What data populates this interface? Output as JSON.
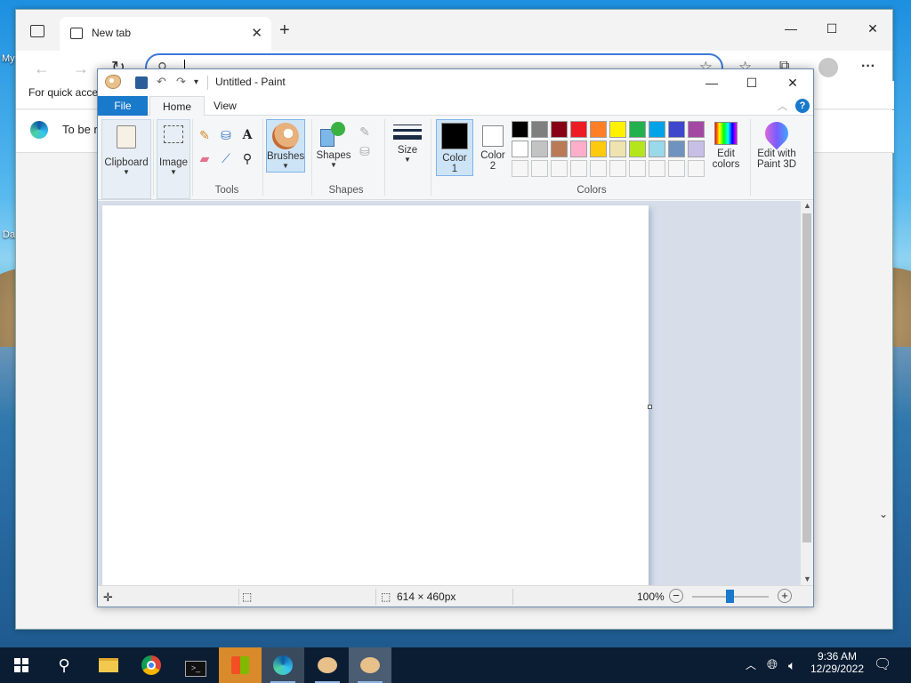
{
  "desktop": {
    "icon_labels": [
      "My",
      "Da"
    ]
  },
  "edge": {
    "tab_title": "New tab",
    "tab_close": "✕",
    "new_tab": "+",
    "controls": {
      "minimize": "—",
      "maximize": "☐",
      "close": "✕"
    },
    "address_value": "",
    "favorites_text": "For quick acce",
    "page_text": "To be r",
    "more": "···"
  },
  "paint": {
    "title": "Untitled - Paint",
    "controls": {
      "minimize": "—",
      "maximize": "☐",
      "close": "✕"
    },
    "tabs": {
      "file": "File",
      "home": "Home",
      "view": "View"
    },
    "ribbon": {
      "clipboard": "Clipboard",
      "image": "Image",
      "tools_group": "Tools",
      "brushes": "Brushes",
      "shapes": "Shapes",
      "shapes_group": "Shapes",
      "size": "Size",
      "color1_line1": "Color",
      "color1_line2": "1",
      "color2_line1": "Color",
      "color2_line2": "2",
      "colors_group": "Colors",
      "edit_colors_line1": "Edit",
      "edit_colors_line2": "colors",
      "paint3d_line1": "Edit with",
      "paint3d_line2": "Paint 3D",
      "help": "?"
    },
    "palette_row1": [
      "#000000",
      "#7f7f7f",
      "#880015",
      "#ed1c24",
      "#ff7f27",
      "#fff200",
      "#22b14c",
      "#00a2e8",
      "#3f48cc",
      "#a349a4"
    ],
    "palette_row2": [
      "#ffffff",
      "#c3c3c3",
      "#b97a57",
      "#ffaec9",
      "#ffc90e",
      "#efe4b0",
      "#b5e61d",
      "#99d9ea",
      "#7092be",
      "#c8bfe7"
    ],
    "status": {
      "canvas_size": "614 × 460px",
      "zoom": "100%"
    }
  },
  "taskbar": {
    "time": "9:36 AM",
    "date": "12/29/2022"
  }
}
